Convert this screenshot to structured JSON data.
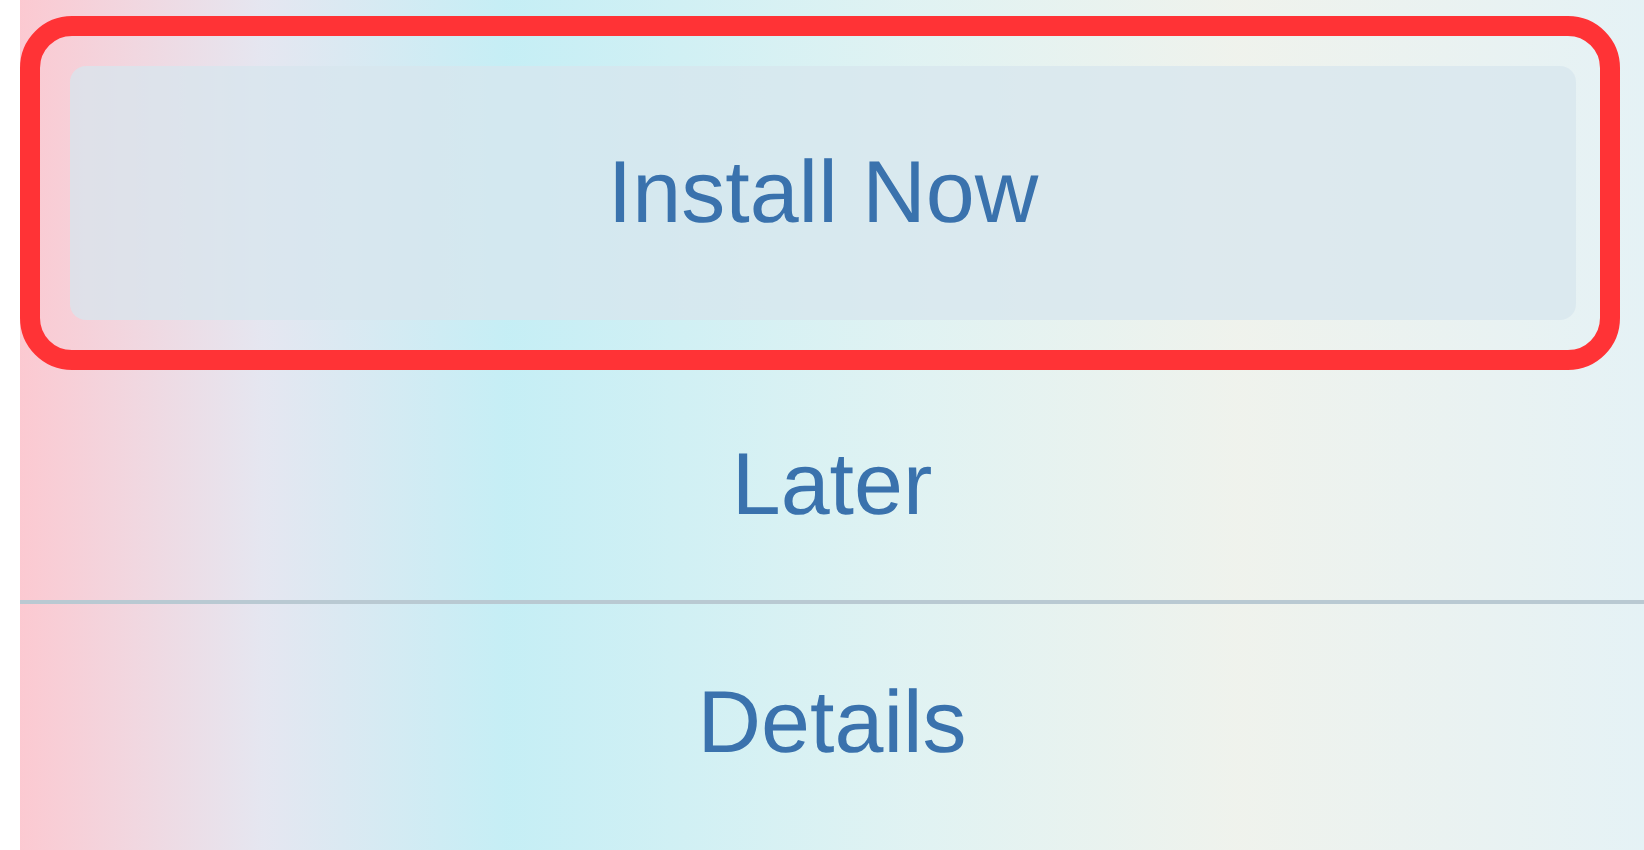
{
  "buttons": [
    {
      "label": "Install Now",
      "highlighted": true
    },
    {
      "label": "Later",
      "highlighted": false
    },
    {
      "label": "Details",
      "highlighted": false
    }
  ]
}
